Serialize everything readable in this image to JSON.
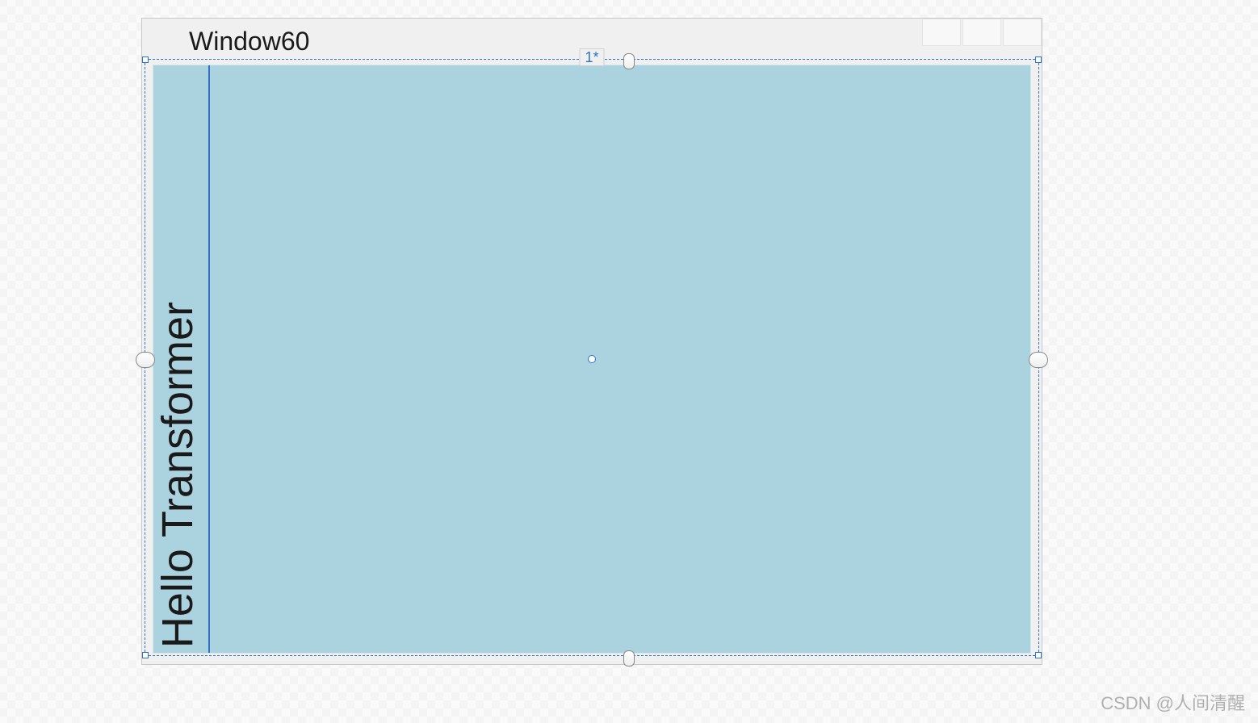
{
  "window": {
    "title": "Window60"
  },
  "designer": {
    "column_size_label": "1*",
    "vertical_text": "Hello Transformer",
    "content_bg": "#abd3df",
    "selection_color": "#2e73c7"
  },
  "watermark": "CSDN @人间清醒"
}
